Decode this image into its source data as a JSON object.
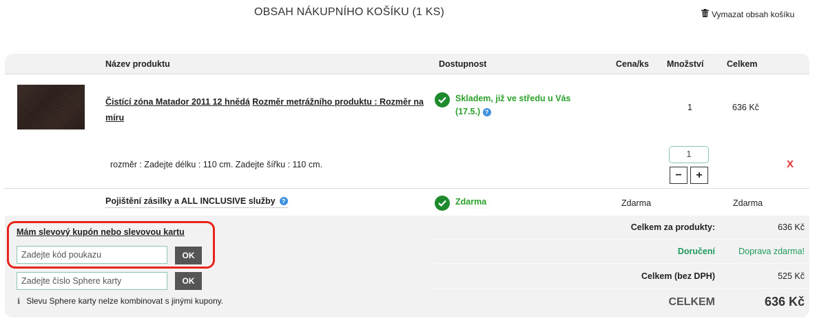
{
  "page": {
    "title": "OBSAH NÁKUPNÍHO KOŠÍKU (1 KS)",
    "clear_cart": "Vymazat obsah košíku"
  },
  "table": {
    "headers": {
      "name": "Název produktu",
      "availability": "Dostupnost",
      "unit_price": "Cena/ks",
      "quantity": "Množství",
      "total": "Celkem"
    }
  },
  "product": {
    "name": "Čistící zóna Matador 2011 12 hnědá",
    "dimension_label": "Rozměr metrážního produktu : Rozměr na míru",
    "availability_line1": "Skladem, již ve středu u Vás",
    "availability_line2": "(17.5.)",
    "help_icon": "?",
    "quantity": "1",
    "total": "636 Kč",
    "size_note": "rozměr : Zadejte délku : 110 cm. Zadejte šířku : 110 cm.",
    "qty_value": "1",
    "minus": "−",
    "plus": "+",
    "remove": "X"
  },
  "insurance": {
    "name": "Pojištění zásilky a ALL INCLUSIVE služby",
    "help_icon": "?",
    "availability": "Zdarma",
    "unit_price": "Zdarma",
    "total": "Zdarma"
  },
  "coupon": {
    "title": "Mám slevový kupón nebo slevovou kartu",
    "voucher_placeholder": "Zadejte kód poukazu",
    "voucher_button": "OK",
    "sphere_placeholder": "Zadejte číslo Sphere karty",
    "sphere_button": "OK",
    "info_icon": "ℹ",
    "note": "Slevu Sphere karty nelze kombinovat s jinými kupony."
  },
  "summary": {
    "products_label": "Celkem za produkty:",
    "products_value": "636 Kč",
    "delivery_label": "Doručení",
    "delivery_value": "Doprava zdarma!",
    "net_label": "Celkem (bez DPH)",
    "net_value": "525 Kč",
    "total_label": "CELKEM",
    "total_value": "636 Kč"
  },
  "colors": {
    "availability_green": "#2ba12b",
    "check_green": "#1e8a2e",
    "delivery_green": "#1f9a5d",
    "highlight_red": "#e8231a",
    "remove_red": "#dd3333",
    "ok_button": "#555555"
  }
}
